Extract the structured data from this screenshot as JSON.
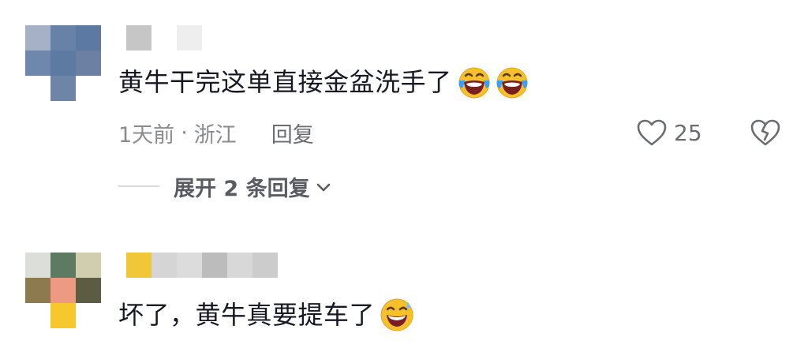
{
  "comments": [
    {
      "avatar_colors": [
        "#a6b1c8",
        "#6881a6",
        "#5c79a1",
        "#6f87ad",
        "#5d7aa2",
        "#6b80a3",
        "#ffffff",
        "#6e85a8",
        "#ffffff"
      ],
      "username_colors": [
        "#c6c6c6",
        "#ffffff",
        "#eeeeee"
      ],
      "text": "黄牛干完这单直接金盆洗手了",
      "emojis": [
        "laugh-cry-emoji",
        "laugh-cry-emoji"
      ],
      "time": "1天前",
      "separator": "·",
      "location": "浙江",
      "reply_label": "回复",
      "likes": "25",
      "expand_label": "展开 2 条回复"
    },
    {
      "avatar_colors": [
        "#dcdfd9",
        "#5f7a63",
        "#d1ceb0",
        "#8e7a4f",
        "#ee9a83",
        "#5c5c45",
        "#ffffff",
        "#f7c82c",
        "#ffffff"
      ],
      "username_colors": [
        "#f1c737",
        "#d5d5d5",
        "#dcdcdc",
        "#bcbcbc",
        "#d8d8d8",
        "#cccccc"
      ],
      "text": "坏了，黄牛真要提车了",
      "emojis": [
        "grinning-sweat-emoji"
      ]
    }
  ]
}
